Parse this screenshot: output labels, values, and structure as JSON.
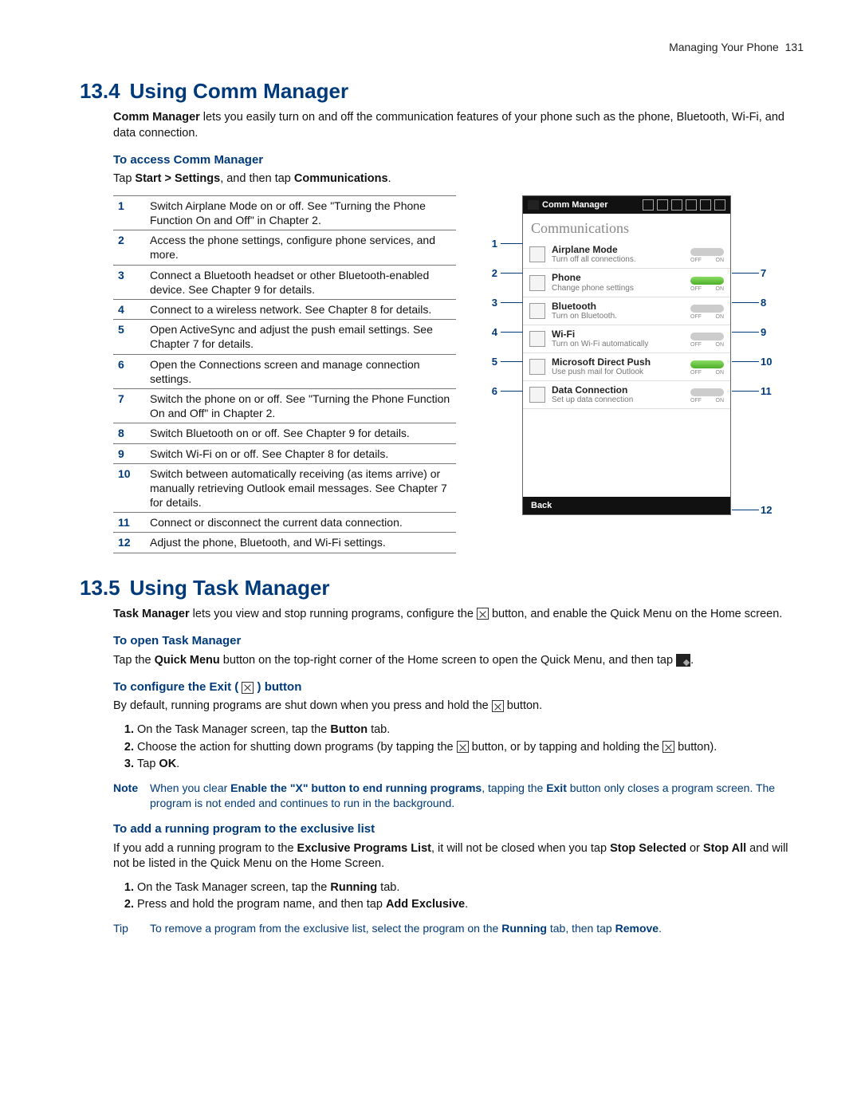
{
  "pageHeader": {
    "text": "Managing Your Phone",
    "num": "131"
  },
  "sec134": {
    "num": "13.4",
    "title": "Using Comm Manager",
    "intro1": "Comm Manager",
    "intro2": " lets you easily turn on and off the communication features of your phone such as the phone, Bluetooth, Wi-Fi, and data connection.",
    "sub1": "To access Comm Manager",
    "sub1text_a": "Tap ",
    "sub1text_b": "Start > Settings",
    "sub1text_c": ", and then tap ",
    "sub1text_d": "Communications",
    "sub1text_e": ".",
    "rows": [
      {
        "n": "1",
        "t": "Switch Airplane Mode on or off. See \"Turning the Phone Function On and Off\" in Chapter 2."
      },
      {
        "n": "2",
        "t": "Access the phone settings, configure phone services, and more."
      },
      {
        "n": "3",
        "t": "Connect a Bluetooth headset or other Bluetooth-enabled device. See Chapter 9 for details."
      },
      {
        "n": "4",
        "t": "Connect to a wireless network. See Chapter 8 for details."
      },
      {
        "n": "5",
        "t": "Open ActiveSync and adjust the push email settings. See Chapter 7 for details."
      },
      {
        "n": "6",
        "t": "Open the Connections screen and manage connection settings."
      },
      {
        "n": "7",
        "t": "Switch the phone on or off. See \"Turning the Phone Function On and Off\" in Chapter 2."
      },
      {
        "n": "8",
        "t": "Switch Bluetooth on or off. See Chapter 9 for details."
      },
      {
        "n": "9",
        "t": "Switch Wi-Fi on or off. See Chapter 8 for details."
      },
      {
        "n": "10",
        "t": "Switch between automatically receiving (as items arrive) or manually retrieving Outlook email messages. See Chapter 7 for details."
      },
      {
        "n": "11",
        "t": "Connect or disconnect the current data connection."
      },
      {
        "n": "12",
        "t": "Adjust the phone, Bluetooth, and Wi-Fi settings."
      }
    ],
    "shot": {
      "bar_title": "Comm Manager",
      "subtitle": "Communications",
      "back": "Back",
      "off": "OFF",
      "on": "ON",
      "items": [
        {
          "t": "Airplane Mode",
          "s": "Turn off all connections.",
          "on": false
        },
        {
          "t": "Phone",
          "s": "Change phone settings",
          "on": true
        },
        {
          "t": "Bluetooth",
          "s": "Turn on Bluetooth.",
          "on": false
        },
        {
          "t": "Wi-Fi",
          "s": "Turn on Wi-Fi automatically",
          "on": false
        },
        {
          "t": "Microsoft Direct Push",
          "s": "Use push mail for Outlook",
          "on": true
        },
        {
          "t": "Data Connection",
          "s": "Set up data connection",
          "on": false
        }
      ],
      "left_labels": [
        "1",
        "2",
        "3",
        "4",
        "5",
        "6"
      ],
      "right_labels": [
        "7",
        "8",
        "9",
        "10",
        "11",
        "12"
      ]
    }
  },
  "sec135": {
    "num": "13.5",
    "title": "Using Task Manager",
    "intro1": "Task Manager",
    "intro2a": " lets you view and stop running programs, configure the ",
    "intro2b": " button, and enable the Quick Menu on the Home screen.",
    "sub1": "To open Task Manager",
    "sub1text_a": "Tap the ",
    "sub1text_b": "Quick Menu",
    "sub1text_c": " button on the top-right corner of the Home screen to open the Quick Menu, and then tap ",
    "sub1text_d": ".",
    "sub2_a": "To configure the Exit ( ",
    "sub2_b": " ) button",
    "sub2text_a": "By default, running programs are shut down when you press and hold the ",
    "sub2text_b": " button.",
    "steps2": [
      {
        "pre": "On the Task Manager screen, tap the ",
        "bold": "Button",
        "post": " tab."
      },
      {
        "pre": "Choose the action for shutting down programs (by tapping the ",
        "mid": " button, or by tapping and holding the ",
        "post": " button)."
      },
      {
        "pre": "Tap ",
        "bold": "OK",
        "post": "."
      }
    ],
    "note_lbl": "Note",
    "note_a": "When you clear ",
    "note_bold": "Enable the \"X\" button to end running programs",
    "note_b": ", tapping the ",
    "note_bold2": "Exit",
    "note_c": " button only closes a program screen. The program is not ended and continues to run in the background.",
    "sub3": "To add a running program to the exclusive list",
    "sub3text_a": "If you add a running program to the ",
    "sub3text_b": "Exclusive Programs List",
    "sub3text_c": ", it will not be closed when you tap ",
    "sub3text_d": "Stop Selected",
    "sub3text_e": " or ",
    "sub3text_f": "Stop All",
    "sub3text_g": " and will not be listed in the Quick Menu on the Home Screen.",
    "steps3": [
      {
        "pre": "On the Task Manager screen, tap the ",
        "bold": "Running",
        "post": " tab."
      },
      {
        "pre": "Press and hold the program name, and then tap ",
        "bold": "Add Exclusive",
        "post": "."
      }
    ],
    "tip_lbl": "Tip",
    "tip_a": "To remove a program from the exclusive list, select the program on the ",
    "tip_bold": "Running",
    "tip_b": " tab, then tap ",
    "tip_bold2": "Remove",
    "tip_c": "."
  }
}
